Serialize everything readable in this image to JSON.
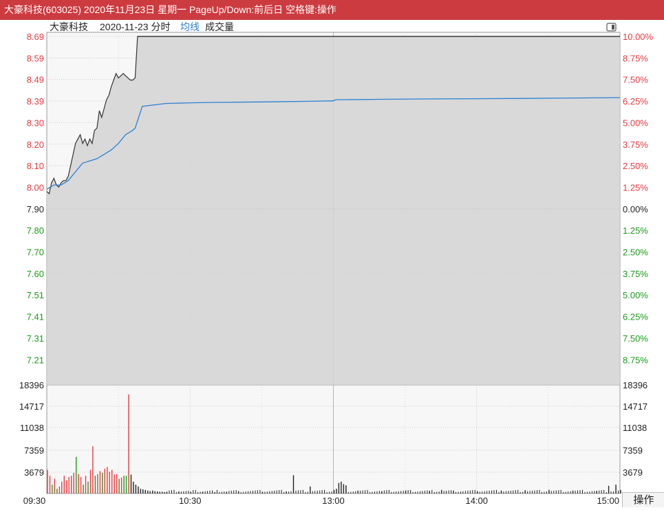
{
  "window": {
    "title": "大豪科技(603025) 2020年11月23日 星期一 PageUp/Down:前后日 空格键:操作"
  },
  "header": {
    "stock_name": "大豪科技",
    "date_label": "2020-11-23 分时",
    "avg_label": "均线",
    "volume_label": "成交量"
  },
  "colors": {
    "title_bar": "#cc3b40",
    "up": "#e8393f",
    "down": "#1a9a1a",
    "price_line": "#333333",
    "avg_line": "#2a7fd4"
  },
  "operate_button": {
    "label": "操作"
  },
  "chart_data": [
    {
      "type": "line",
      "title": "",
      "xlabel": "",
      "ylabel": "",
      "x_ticks": [
        "09:30",
        "10:30",
        "13:00",
        "14:00",
        "15:00"
      ],
      "ylim": [
        7.16,
        8.69
      ],
      "price_ticks": [
        "8.69",
        "8.59",
        "8.49",
        "8.39",
        "8.30",
        "8.20",
        "8.10",
        "8.00",
        "7.90",
        "7.80",
        "7.70",
        "7.60",
        "7.51",
        "7.41",
        "7.31",
        "7.21"
      ],
      "percent_ticks": [
        "10.00%",
        "8.75%",
        "7.50%",
        "6.25%",
        "5.00%",
        "3.75%",
        "2.50%",
        "1.25%",
        "0.00%",
        "1.25%",
        "2.50%",
        "3.75%",
        "5.00%",
        "6.25%",
        "7.50%",
        "8.75%"
      ],
      "grid": true,
      "series": [
        {
          "name": "",
          "x": [
            0,
            1,
            2,
            3,
            4,
            5,
            6,
            7,
            8,
            9,
            10,
            11,
            12,
            13,
            14,
            15,
            16,
            17,
            18,
            19,
            20,
            21,
            22,
            23,
            24,
            25,
            26,
            27,
            28,
            29,
            30,
            31,
            32,
            33,
            34,
            35,
            36,
            37,
            38,
            39,
            40,
            240
          ],
          "values": [
            7.98,
            7.97,
            8.02,
            8.04,
            8.01,
            8.0,
            8.02,
            8.03,
            8.03,
            8.05,
            8.1,
            8.15,
            8.2,
            8.22,
            8.24,
            8.2,
            8.22,
            8.19,
            8.22,
            8.2,
            8.26,
            8.27,
            8.35,
            8.32,
            8.36,
            8.4,
            8.42,
            8.46,
            8.49,
            8.52,
            8.5,
            8.51,
            8.52,
            8.51,
            8.5,
            8.49,
            8.49,
            8.5,
            8.69,
            8.69,
            8.69,
            8.69
          ]
        },
        {
          "name": "均线",
          "x": [
            0,
            3,
            6,
            9,
            12,
            15,
            18,
            21,
            24,
            27,
            30,
            33,
            36,
            37,
            40,
            50,
            60,
            70,
            90,
            110,
            120,
            121,
            140,
            160,
            180,
            200,
            220,
            240
          ],
          "values": [
            7.99,
            8.01,
            8.01,
            8.03,
            8.07,
            8.11,
            8.12,
            8.13,
            8.15,
            8.17,
            8.2,
            8.24,
            8.26,
            8.27,
            8.37,
            8.383,
            8.386,
            8.388,
            8.39,
            8.393,
            8.395,
            8.4,
            8.402,
            8.404,
            8.405,
            8.406,
            8.408,
            8.41
          ]
        }
      ]
    },
    {
      "type": "bar",
      "title": "成交量",
      "xlabel": "",
      "ylabel": "",
      "ylim": [
        0,
        18396
      ],
      "y_ticks": [
        "18396",
        "14717",
        "11038",
        "7359",
        "3679"
      ],
      "x": [
        0,
        1,
        2,
        3,
        4,
        5,
        6,
        7,
        8,
        9,
        10,
        11,
        12,
        13,
        14,
        15,
        16,
        17,
        18,
        19,
        20,
        21,
        22,
        23,
        24,
        25,
        26,
        27,
        28,
        29,
        30,
        31,
        32,
        33,
        34,
        35,
        36,
        37,
        38,
        39,
        40,
        41,
        42,
        43,
        44,
        45,
        46,
        47,
        48,
        49,
        50,
        55,
        60,
        65,
        70,
        75,
        80,
        90,
        100,
        103,
        110,
        120,
        121,
        122,
        123,
        124,
        125,
        130,
        140,
        150,
        160,
        165,
        170,
        180,
        190,
        200,
        210,
        220,
        230,
        235,
        238,
        240
      ],
      "values": [
        4000,
        3000,
        1500,
        2500,
        800,
        1200,
        2000,
        3000,
        2200,
        2800,
        3000,
        3500,
        6200,
        3300,
        2800,
        1500,
        3000,
        2000,
        4000,
        8000,
        3000,
        3300,
        3800,
        3500,
        4200,
        4500,
        3700,
        4000,
        3200,
        3300,
        2500,
        2700,
        3000,
        3000,
        16800,
        3200,
        2000,
        1500,
        1200,
        800,
        700,
        600,
        500,
        400,
        500,
        400,
        350,
        300,
        300,
        250,
        300,
        350,
        300,
        300,
        250,
        300,
        400,
        300,
        350,
        3100,
        1200,
        600,
        800,
        1800,
        2000,
        1600,
        1400,
        500,
        400,
        500,
        450,
        600,
        500,
        400,
        500,
        550,
        600,
        500,
        450,
        1300,
        1500,
        600
      ],
      "colors": [
        "up",
        "up",
        "down",
        "up",
        "down",
        "up",
        "up",
        "up",
        "up",
        "up",
        "up",
        "up",
        "down",
        "up",
        "up",
        "down",
        "up",
        "down",
        "up",
        "up",
        "down",
        "up",
        "up",
        "down",
        "up",
        "up",
        "up",
        "up",
        "up",
        "up",
        "down",
        "up",
        "down",
        "down",
        "up",
        "flat",
        "flat",
        "flat",
        "flat",
        "flat",
        "flat",
        "flat",
        "flat",
        "flat",
        "flat",
        "flat",
        "flat",
        "flat",
        "flat",
        "flat",
        "flat",
        "flat",
        "flat",
        "flat",
        "flat",
        "flat",
        "flat",
        "flat",
        "flat",
        "flat",
        "flat",
        "flat",
        "flat",
        "flat",
        "flat",
        "flat",
        "flat",
        "flat",
        "flat",
        "flat",
        "flat",
        "flat",
        "flat",
        "flat",
        "flat",
        "flat",
        "flat",
        "flat",
        "flat",
        "flat",
        "flat",
        "flat"
      ]
    }
  ]
}
